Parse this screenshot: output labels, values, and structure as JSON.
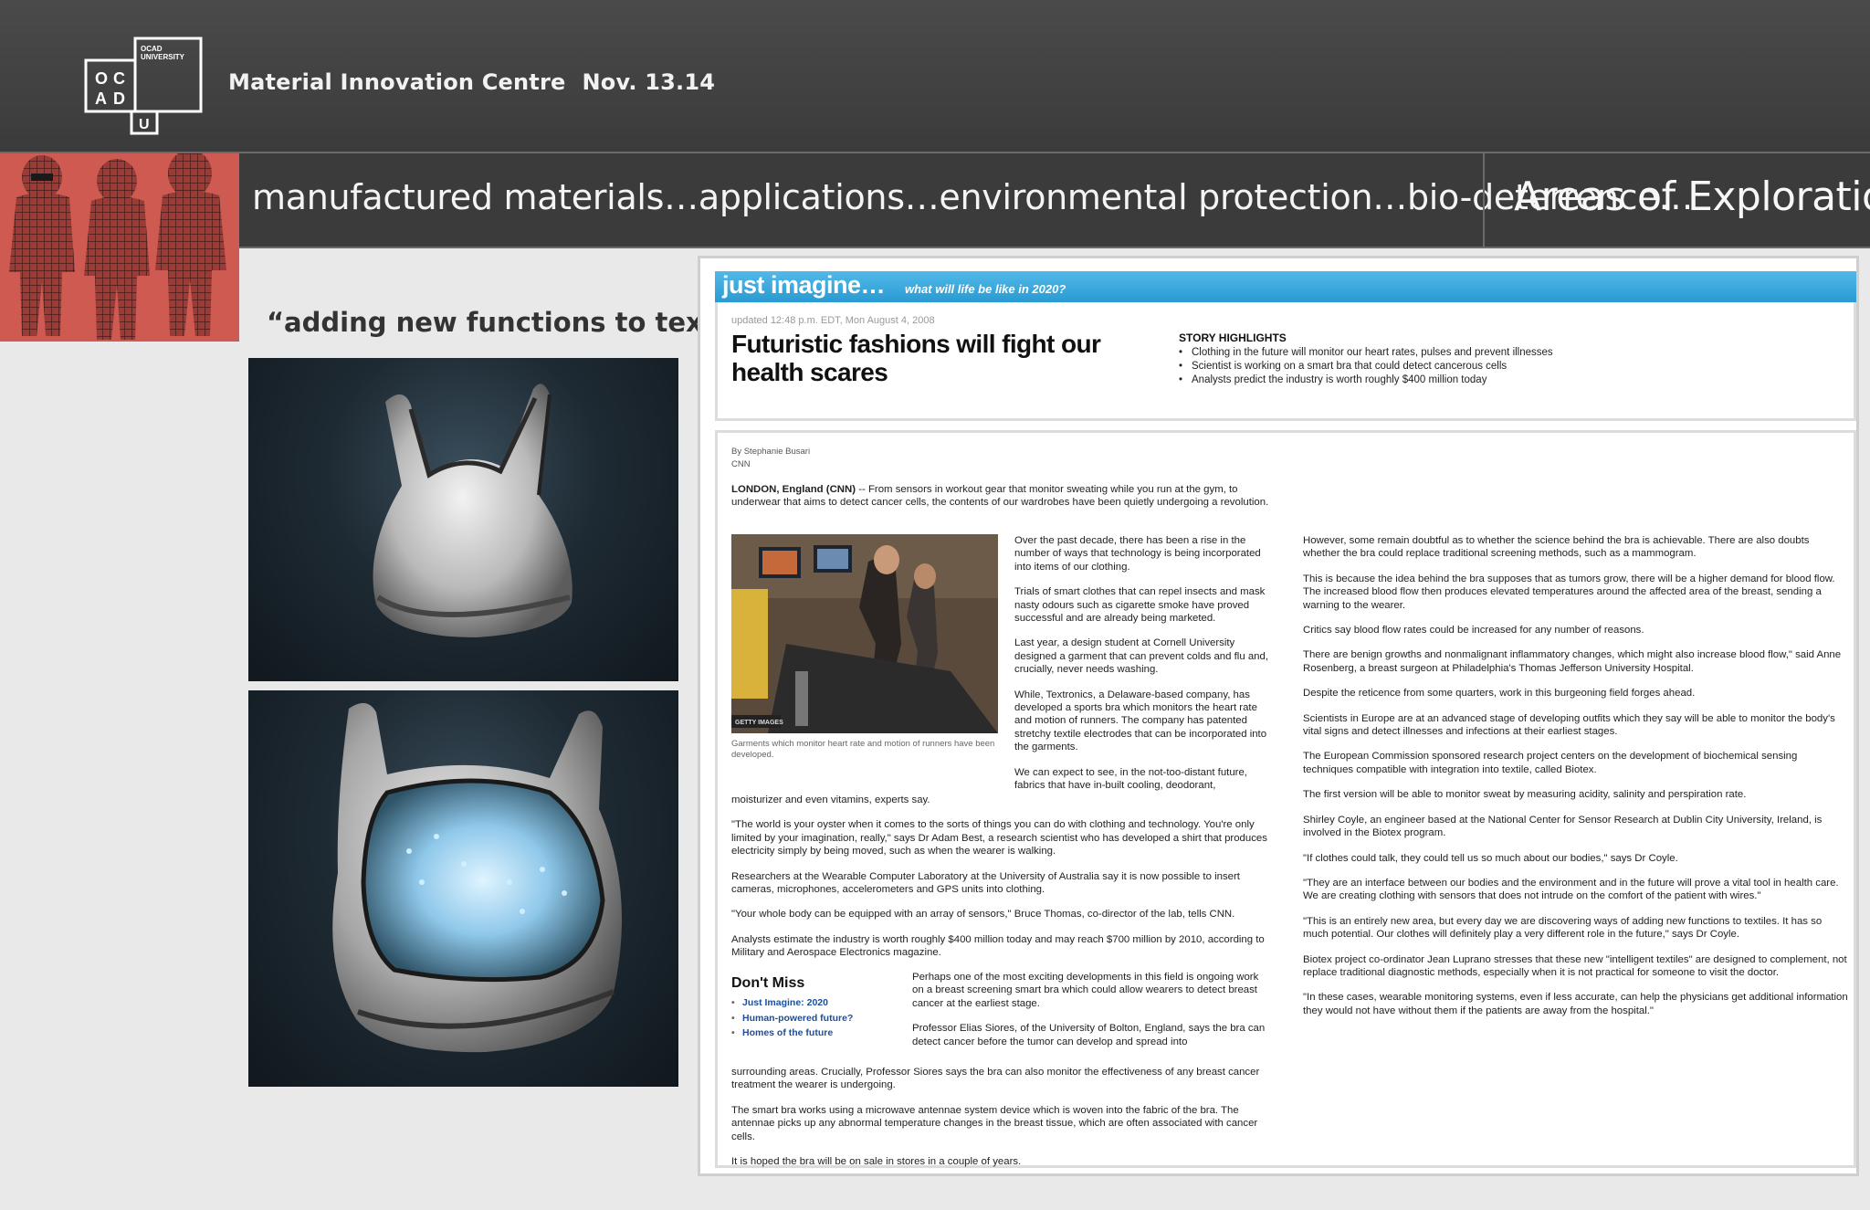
{
  "header": {
    "logo": {
      "line1": "OCAD",
      "line2": "UNIVERSITY",
      "letters": [
        "O",
        "C",
        "A",
        "D",
        "U"
      ]
    },
    "title": "Material Innovation Centre",
    "date": "Nov. 13.14"
  },
  "banner": {
    "text": "manufactured materials…applications…environmental protection…bio-deterrence…",
    "right_title": "Areas of Exploration"
  },
  "left": {
    "quote": "“adding new functions to textiles”"
  },
  "article": {
    "brand": "just imagine…",
    "brand_sub": "what will life be like in 2020?",
    "updated": "updated 12:48 p.m. EDT, Mon August 4, 2008",
    "headline": "Futuristic fashions will fight our health scares",
    "highlights_title": "STORY HIGHLIGHTS",
    "highlights": [
      "Clothing in the future will monitor our heart rates, pulses and prevent illnesses",
      "Scientist is working on a smart bra that could detect cancerous cells",
      "Analysts predict the industry is worth roughly $400 million today"
    ],
    "byline": "By Stephanie Busari",
    "source": "CNN",
    "lead_dateline": "LONDON, England (CNN)",
    "lead": " -- From sensors in workout gear that monitor sweating while you run at the gym, to underwear that aims to detect cancer cells, the contents of our wardrobes have been quietly undergoing a revolution.",
    "photo_credit": "GETTY IMAGES",
    "caption": "Garments which monitor heart rate and motion of runners have been developed.",
    "col_mid": [
      "Over the past decade, there has been a rise in the number of ways that technology is being incorporated into items of our clothing.",
      "Trials of smart clothes that can repel insects and mask nasty odours such as cigarette smoke have proved successful and are already being marketed.",
      "Last year, a design student at Cornell University designed a garment that can prevent colds and flu and, crucially, never needs washing.",
      "While, Textronics, a Delaware-based company, has developed a sports bra which monitors the heart rate and motion of runners. The company has patented stretchy textile electrodes that can be incorporated into the garments.",
      "We can expect to see, in the not-too-distant future, fabrics that have in-built cooling, deodorant,"
    ],
    "col_left_lower": [
      "moisturizer and even vitamins, experts say.",
      "\"The world is your oyster when it comes to the sorts of things you can do with clothing and technology. You're only limited by your imagination, really,\" says Dr Adam Best, a research scientist who has developed a shirt that produces electricity simply by being moved, such as when the wearer is walking.",
      "Researchers at the Wearable Computer Laboratory at the University of Australia say it is now possible to insert cameras, microphones, accelerometers and GPS units into clothing.",
      "\"Your whole body can be equipped with an array of sensors,\" Bruce Thomas, co-director of the lab, tells CNN.",
      "Analysts estimate the industry is worth roughly $400 million today and may reach $700 million by 2010, according to Military and Aerospace Electronics magazine."
    ],
    "dont_miss_title": "Don't Miss",
    "dont_miss": [
      "Just Imagine: 2020",
      "Human-powered future?",
      "Homes of the future"
    ],
    "dm_text": [
      "Perhaps one of the most exciting developments in this field is ongoing work on a breast screening smart bra which could allow wearers to detect breast cancer at the earliest stage.",
      "Professor Elias Siores, of the University of Bolton, England, says the bra can detect cancer before the tumor can develop and spread into"
    ],
    "col_left_bottom": [
      "surrounding areas. Crucially, Professor Siores says the bra can also monitor the effectiveness of any breast cancer treatment the wearer is undergoing.",
      "The smart bra works using a microwave antennae system device which is woven into the fabric of the bra. The antennae picks up any abnormal temperature changes in the breast tissue, which are often associated with cancer cells.",
      "It is hoped the bra will be on sale in stores in a couple of years."
    ],
    "col_right": [
      "However, some remain doubtful as to whether the science behind the bra is achievable. There are also doubts whether the bra could replace traditional screening methods, such as a mammogram.",
      "This is because the idea behind the bra supposes that as tumors grow, there will be a higher demand for blood flow. The increased blood flow then produces elevated temperatures around the affected area of the breast, sending a warning to the wearer.",
      "Critics say blood flow rates could be increased for any number of reasons.",
      "There are benign growths and nonmalignant inflammatory changes, which might also increase blood flow,\" said Anne Rosenberg, a breast surgeon at Philadelphia's Thomas Jefferson University Hospital.",
      "Despite the reticence from some quarters, work in this burgeoning field forges ahead.",
      "Scientists in Europe are at an advanced stage of developing outfits which they say will be able to monitor the body's vital signs and detect illnesses and infections at their earliest stages.",
      "The European Commission sponsored research project centers on the development of biochemical sensing techniques compatible with integration into textile, called Biotex.",
      "The first version will be able to monitor sweat by measuring acidity, salinity and perspiration rate.",
      "Shirley Coyle, an engineer based at the National Center for Sensor Research at Dublin City University, Ireland, is involved in the Biotex program.",
      "\"If clothes could talk, they could tell us so much about our bodies,\" says Dr Coyle.",
      "\"They are an interface between our bodies and the environment and in the future will prove a vital tool in health care. We are creating clothing with sensors that does not intrude on the comfort of the patient with wires.\"",
      "\"This is an entirely new area, but every day we are discovering ways of adding new functions to textiles. It has so much potential. Our clothes will definitely play a very different role in the future,\" says Dr Coyle.",
      "Biotex project co-ordinator Jean Luprano stresses that these new \"intelligent textiles\" are designed to complement, not replace traditional diagnostic methods, especially when it is not practical for someone to visit the doctor.",
      "\"In these cases, wearable monitoring systems, even if less accurate, can help the physicians get additional information they would not have without them if the patients are away from the hospital.\""
    ]
  },
  "colors": {
    "header_bg": "#3b3b3b",
    "banner_red": "#cf5a51",
    "accent_blue": "#2a9ad2",
    "link_blue": "#1a4f9c"
  }
}
